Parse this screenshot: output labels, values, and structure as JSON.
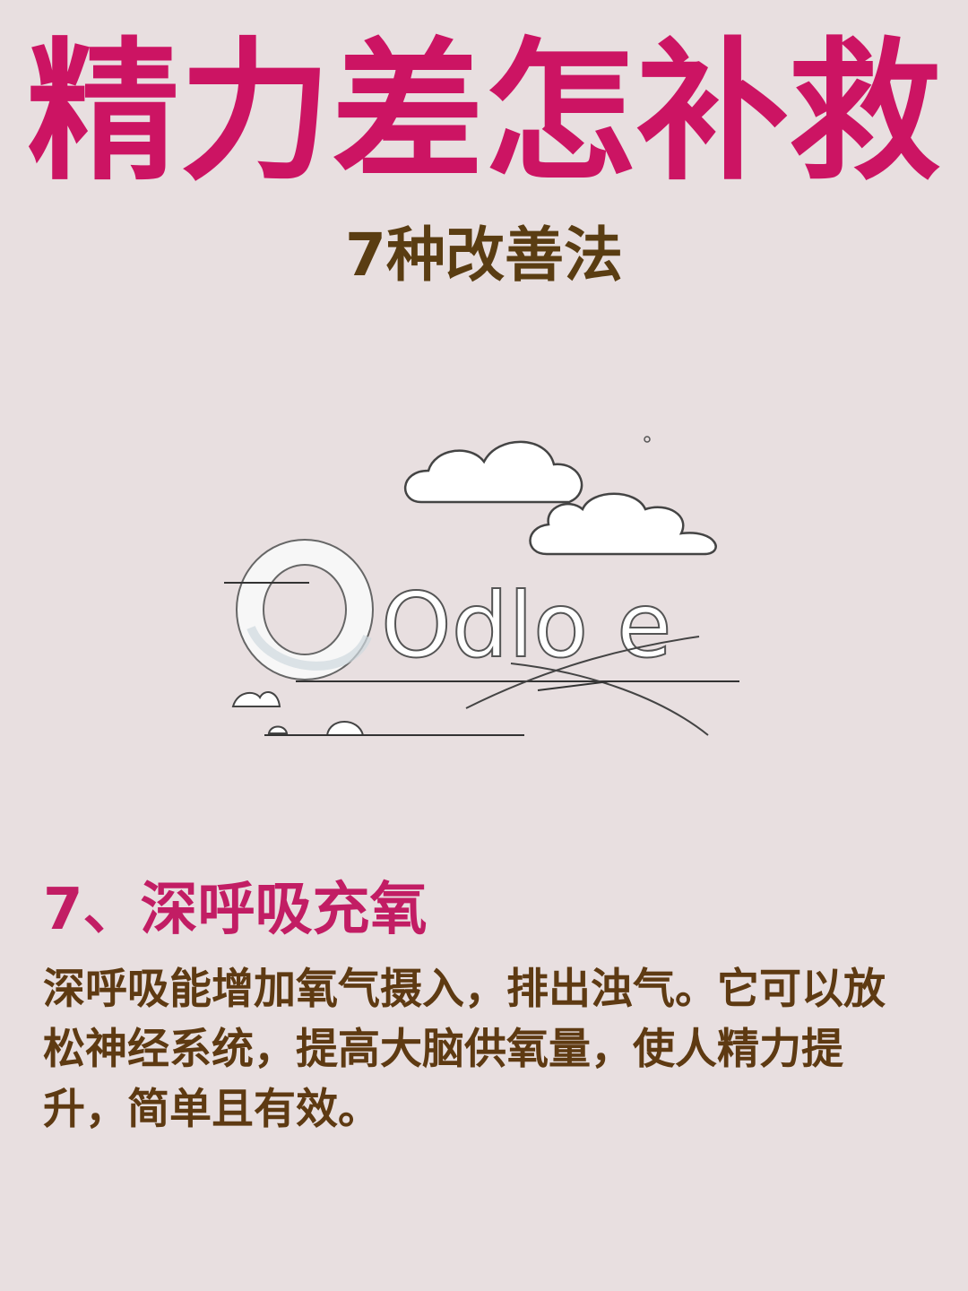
{
  "header": {
    "title": "精力差怎补救",
    "subtitle": "7种改善法"
  },
  "illustration": {
    "icon": "clouds-illustration",
    "text": "Odlo e"
  },
  "section": {
    "heading": "7、深呼吸充氧",
    "body": "深呼吸能增加氧气摄入，排出浊气。它可以放松神经系统，提高大脑供氧量，使人精力提升，简单且有效。"
  },
  "colors": {
    "background": "#e8dfe0",
    "title": "#cc1463",
    "subtitle": "#5a3d12",
    "heading": "#c21d64",
    "body": "#5e3a12"
  }
}
